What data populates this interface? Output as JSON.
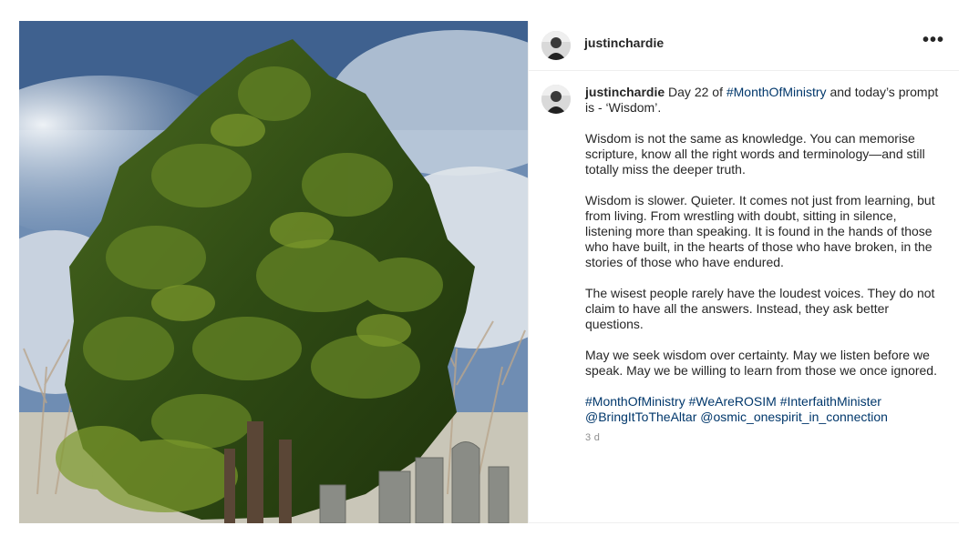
{
  "post": {
    "username": "justinchardie",
    "more_label": "•••",
    "caption": {
      "username": "justinchardie",
      "line1_pre": "Day 22 of ",
      "line1_tag": "#MonthOfMinistry",
      "line1_post": " and today’s prompt is - ‘Wisdom’.",
      "p2": "Wisdom is not the same as knowledge. You can memorise scripture, know all the right words and terminology—and still totally miss the deeper truth.",
      "p3": "Wisdom is slower. Quieter. It comes not just from learning, but from living. From wrestling with doubt, sitting in silence, listening more than speaking. It is found in the hands of those who have built, in the hearts of those who have broken, in the stories of those who have endured.",
      "p4": "The wisest people rarely have the loudest voices. They do not claim to have all the answers. Instead, they ask better questions.",
      "p5": "May we seek wisdom over certainty. May we listen before we speak. May we be willing to learn from those we once ignored.",
      "tags": [
        "#MonthOfMinistry",
        "#WeAreROSIM",
        "#InterfaithMinister",
        "@BringItToTheAltar",
        "@osmic_onespirit_in_connection"
      ]
    },
    "time": "3 d"
  },
  "colors": {
    "link": "#00376b",
    "text": "#262626",
    "muted": "#8e8e8e"
  }
}
